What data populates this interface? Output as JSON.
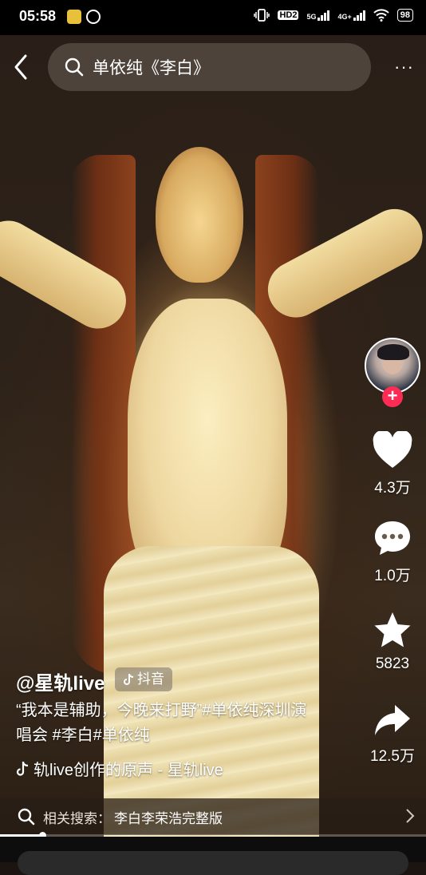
{
  "status_bar": {
    "time": "05:58",
    "network_hd": "HD2",
    "network_5g": "5G",
    "network_4g": "4G+",
    "battery": "98"
  },
  "top_bar": {
    "search_query": "单依纯《李白》",
    "more_label": "···"
  },
  "actions": {
    "like_count": "4.3万",
    "comment_count": "1.0万",
    "favorite_count": "5823",
    "share_count": "12.5万",
    "follow_symbol": "+"
  },
  "caption": {
    "author": "@星轨live",
    "badge": "抖音",
    "description": "“我本是辅助，今晚来打野”#单依纯深圳演唱会 #李白#单依纯",
    "music": "轨live创作的原声 - 星轨live"
  },
  "related_search": {
    "label": "相关搜索：",
    "term": "李白李荣浩完整版"
  },
  "playback": {
    "progress": 0.1
  },
  "colors": {
    "accent": "#fe2c55",
    "background": "#000000"
  }
}
